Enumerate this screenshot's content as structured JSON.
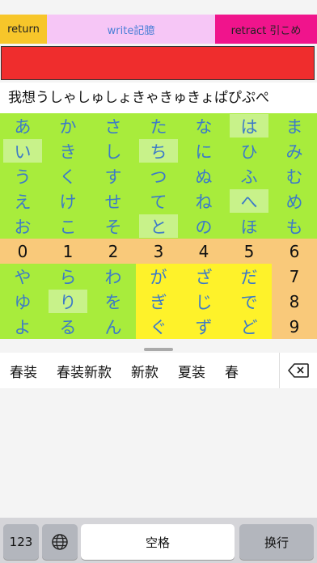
{
  "toolbar": {
    "return_label": "return",
    "write_label": "write記臆",
    "retract_label": "retract  引こめ"
  },
  "text_line": "我想うしゃしゅしょきゃきゅきょぱぴぷぺ",
  "grid": [
    [
      "あ",
      "か",
      "さ",
      "た",
      "な",
      "は",
      "ま"
    ],
    [
      "い",
      "き",
      "し",
      "ち",
      "に",
      "ひ",
      "み"
    ],
    [
      "う",
      "く",
      "す",
      "つ",
      "ぬ",
      "ふ",
      "む"
    ],
    [
      "え",
      "け",
      "せ",
      "て",
      "ね",
      "へ",
      "め"
    ],
    [
      "お",
      "こ",
      "そ",
      "と",
      "の",
      "ほ",
      "も"
    ],
    [
      "0",
      "1",
      "2",
      "3",
      "4",
      "5",
      "6"
    ],
    [
      "や",
      "ら",
      "わ",
      "が",
      "ざ",
      "だ",
      "7"
    ],
    [
      "ゆ",
      "り",
      "を",
      "ぎ",
      "じ",
      "で",
      "8"
    ],
    [
      "よ",
      "る",
      "ん",
      "ぐ",
      "ず",
      "ど",
      "9"
    ]
  ],
  "colors": {
    "green": "#a8ec3c",
    "orange": "#f9c97a",
    "yellow": "#fef22a",
    "highlight": "#c8f28a"
  },
  "suggestions": [
    "春装",
    "春装新款",
    "新款",
    "夏装",
    "春"
  ],
  "keys": {
    "num_label": "123",
    "space_label": "空格",
    "enter_label": "换行"
  },
  "icons": {
    "delete": "delete-backward-icon",
    "globe": "globe-icon"
  }
}
